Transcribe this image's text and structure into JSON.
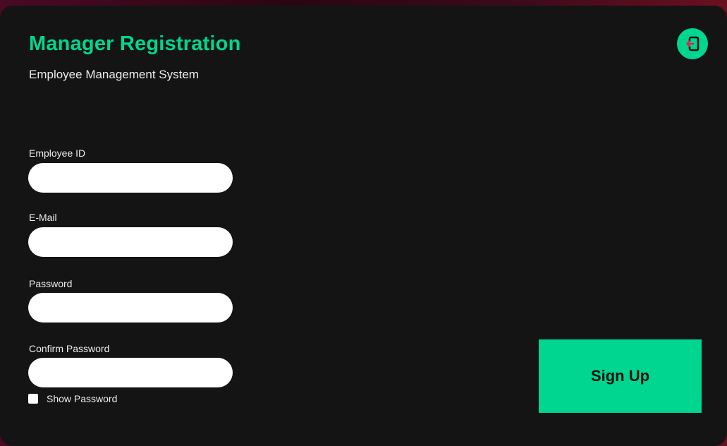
{
  "header": {
    "title": "Manager Registration",
    "subtitle": "Employee Management System",
    "exit_icon": "logout-icon"
  },
  "form": {
    "employee_id": {
      "label": "Employee ID",
      "value": ""
    },
    "email": {
      "label": "E-Mail",
      "value": ""
    },
    "password": {
      "label": "Password",
      "value": ""
    },
    "confirm_password": {
      "label": "Confirm Password",
      "value": ""
    },
    "show_password": {
      "label": "Show Password",
      "checked": false
    }
  },
  "actions": {
    "signup_label": "Sign Up"
  },
  "colors": {
    "accent": "#00d68f",
    "window_bg": "#141414",
    "exit_arrow": "#e0244a"
  }
}
